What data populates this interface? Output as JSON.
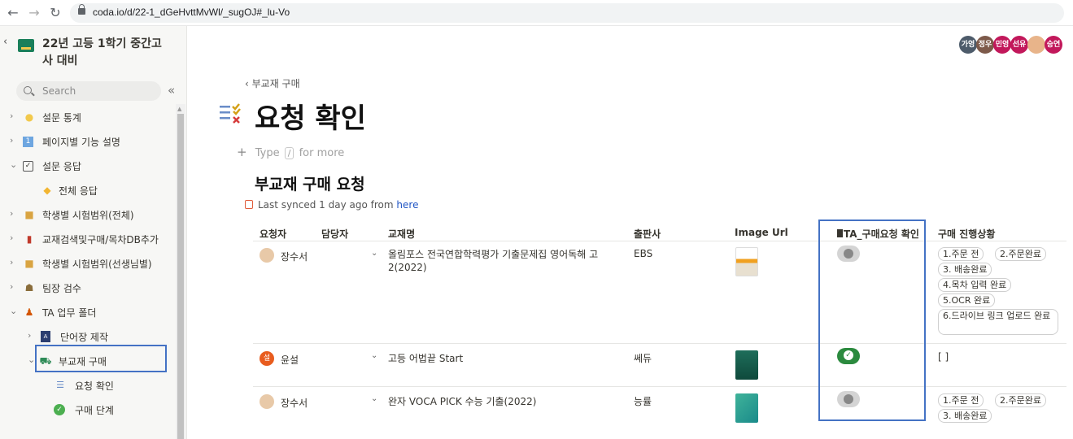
{
  "browser": {
    "url": "coda.io/d/22-1_dGeHvttMvWl/_sugOJ#_lu-Vo"
  },
  "sidebar": {
    "doc_title": "22년 고등 1학기 중간고사 대비",
    "search_placeholder": "Search",
    "items": [
      {
        "label": "설문 통계",
        "icon": "lightbulb-icon"
      },
      {
        "label": "페이지별 기능 설명",
        "icon": "number-one-icon"
      },
      {
        "label": "설문 응답",
        "icon": "checkbox-icon"
      },
      {
        "label": "전체 응답",
        "icon": "tag-icon"
      },
      {
        "label": "학생별 시험범위(전체)",
        "icon": "package-icon"
      },
      {
        "label": "교재검색및구매/목차DB추가",
        "icon": "books-icon"
      },
      {
        "label": "학생별 시험범위(선생님별)",
        "icon": "package-icon"
      },
      {
        "label": "팀장 검수",
        "icon": "team-icon"
      },
      {
        "label": "TA 업무 폴더",
        "icon": "people-icon"
      },
      {
        "label": "단어장 제작",
        "icon": "dictionary-icon"
      },
      {
        "label": "부교재 구매",
        "icon": "cart-icon"
      },
      {
        "label": "요청 확인",
        "icon": "checklist-icon"
      },
      {
        "label": "구매 단계",
        "icon": "check-circle-icon"
      }
    ]
  },
  "main": {
    "avatars": [
      "가영",
      "정우",
      "민영",
      "선유",
      "",
      "승연"
    ],
    "avatar_colors": [
      "#4d5b6a",
      "#7d5a4a",
      "#c2185b",
      "#c2185b",
      "#e8b48a",
      "#c2185b"
    ],
    "breadcrumb": "부교재 구매",
    "page_title": "요청 확인",
    "type_hint_prefix": "Type",
    "type_hint_key": "/",
    "type_hint_suffix": "for more",
    "section_title": "부교재 구매 요청",
    "synced_text": "Last synced 1 day ago from",
    "synced_link": "here"
  },
  "table": {
    "columns": [
      "요청자",
      "담당자",
      "교재명",
      "출판사",
      "Image Url",
      "TA_구매요청 확인",
      "구매 진행상황"
    ],
    "rows": [
      {
        "requester": "장수서",
        "title": "올림포스 전국연합학력평가 기출문제집 영어독해 고2(2022)",
        "publisher": "EBS",
        "confirmed": false,
        "status": [
          "1.주문 전",
          "2.주문완료",
          "3. 배송완료",
          "4.목차 입력 완료",
          "5.OCR 완료",
          "6.드라이브 링크 업로드 완료"
        ]
      },
      {
        "requester_initial": "설",
        "requester": "윤설",
        "title": "고등 어법끝 Start",
        "publisher": "쎄듀",
        "confirmed": true,
        "status_text": "[ ]"
      },
      {
        "requester": "장수서",
        "title": "완자 VOCA PICK 수능 기출(2022)",
        "publisher": "능률",
        "confirmed": false,
        "status": [
          "1.주문 전",
          "2.주문완료",
          "3. 배송완료"
        ]
      }
    ]
  }
}
